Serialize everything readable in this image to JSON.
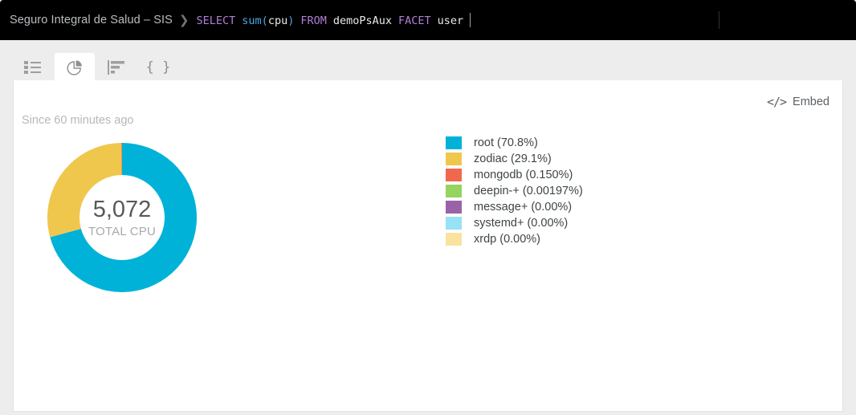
{
  "header": {
    "account": "Seguro Integral de Salud – SIS",
    "separator": "❯",
    "query_tokens": [
      {
        "text": "SELECT",
        "type": "kw"
      },
      {
        "text": "sum",
        "type": "fn"
      },
      {
        "text": "(",
        "type": "punc"
      },
      {
        "text": "cpu",
        "type": "id"
      },
      {
        "text": ")",
        "type": "punc"
      },
      {
        "text": "FROM",
        "type": "kw"
      },
      {
        "text": "demoPsAux",
        "type": "id"
      },
      {
        "text": "FACET",
        "type": "kw"
      },
      {
        "text": "user",
        "type": "id"
      }
    ],
    "query_plain": "SELECT sum(cpu) FROM demoPsAux FACET user"
  },
  "tabs": [
    {
      "name": "table-view",
      "icon": "list-icon",
      "active": false
    },
    {
      "name": "chart-view",
      "icon": "pie-chart-icon",
      "active": true
    },
    {
      "name": "bar-view",
      "icon": "bar-chart-icon",
      "active": false
    },
    {
      "name": "json-view",
      "icon": "braces-icon",
      "glyph": "{ }",
      "active": false
    }
  ],
  "card": {
    "embed_label": "Embed",
    "embed_icon": "</>",
    "time_range": "Since 60 minutes ago"
  },
  "chart_data": {
    "type": "pie",
    "title": "",
    "center_value": "5,072",
    "center_label": "TOTAL CPU",
    "legend_position": "right",
    "labels": [
      "root",
      "zodiac",
      "mongodb",
      "deepin-+",
      "message+",
      "systemd+",
      "xrdp"
    ],
    "percent_labels": [
      "70.8%",
      "29.1%",
      "0.150%",
      "0.00197%",
      "0.00%",
      "0.00%",
      "0.00%"
    ],
    "values": [
      70.8,
      29.1,
      0.15,
      0.00197,
      0.0,
      0.0,
      0.0
    ],
    "colors": [
      "#00b2d8",
      "#f0c74d",
      "#f1684f",
      "#96d35f",
      "#9a63a8",
      "#97e2f5",
      "#fae29f"
    ],
    "legend": [
      {
        "label": "root (70.8%)",
        "color": "#00b2d8"
      },
      {
        "label": "zodiac (29.1%)",
        "color": "#f0c74d"
      },
      {
        "label": "mongodb (0.150%)",
        "color": "#f1684f"
      },
      {
        "label": "deepin-+ (0.00197%)",
        "color": "#96d35f"
      },
      {
        "label": "message+ (0.00%)",
        "color": "#9a63a8"
      },
      {
        "label": "systemd+ (0.00%)",
        "color": "#97e2f5"
      },
      {
        "label": "xrdp (0.00%)",
        "color": "#fae29f"
      }
    ]
  }
}
